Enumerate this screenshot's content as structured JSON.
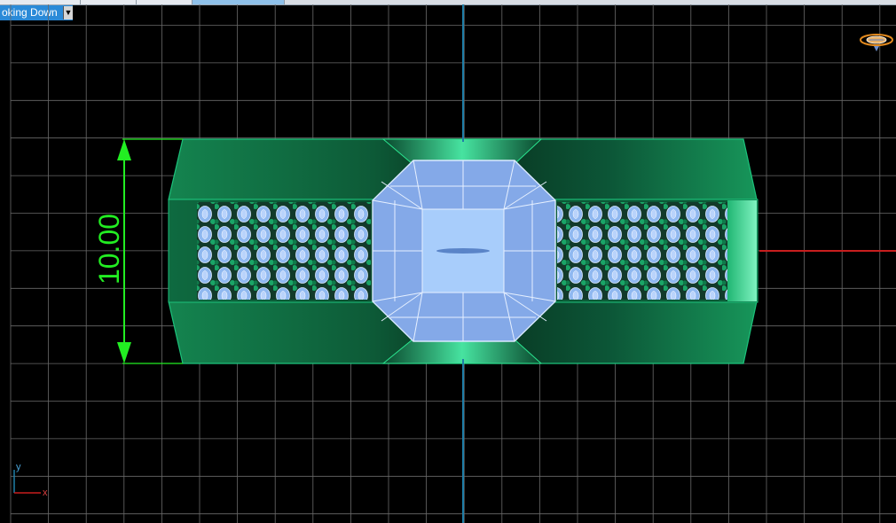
{
  "toolbar": {
    "view_dropdown_label": "oking Down"
  },
  "viewport": {
    "background": "#000000",
    "grid_color": "#6a6a6a",
    "y_axis_color": "#1f7fa8",
    "x_axis_color": "#c81e1e"
  },
  "dimension": {
    "value_label": "10.00",
    "color": "#22ee22"
  },
  "axis_indicator": {
    "y_label": "y",
    "x_label": "x"
  },
  "icons": {
    "view_cube": "view-cube-icon"
  },
  "colors": {
    "metal_dark": "#0b3a26",
    "metal_mid": "#138a55",
    "metal_light": "#3fdc95",
    "gem": "#8fb8f0",
    "gem_edge": "#ffffff"
  }
}
